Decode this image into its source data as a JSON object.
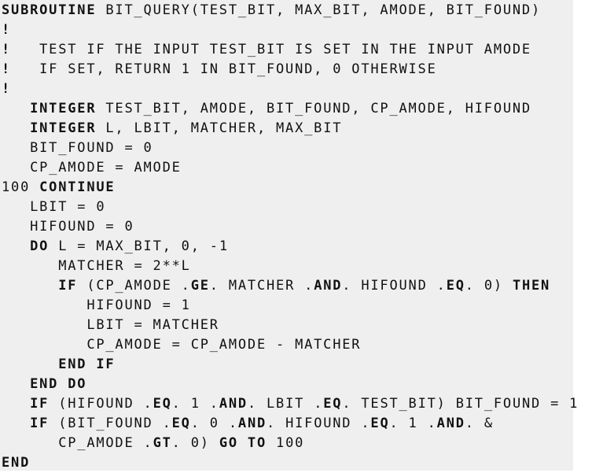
{
  "document": {
    "lines": [
      [
        {
          "t": "SUBROUTINE",
          "b": true
        },
        {
          "t": " BIT_QUERY(TEST_BIT, MAX_BIT, AMODE, BIT_FOUND)",
          "b": false
        }
      ],
      [
        {
          "t": "!",
          "b": true
        }
      ],
      [
        {
          "t": "!",
          "b": true
        },
        {
          "t": "   TEST IF THE INPUT TEST_BIT IS SET IN THE INPUT AMODE",
          "b": false
        }
      ],
      [
        {
          "t": "!",
          "b": true
        },
        {
          "t": "   IF SET, RETURN 1 IN BIT_FOUND, 0 OTHERWISE",
          "b": false
        }
      ],
      [
        {
          "t": "!",
          "b": true
        }
      ],
      [
        {
          "t": "   ",
          "b": false
        },
        {
          "t": "INTEGER",
          "b": true
        },
        {
          "t": " TEST_BIT, AMODE, BIT_FOUND, CP_AMODE, HIFOUND",
          "b": false
        }
      ],
      [
        {
          "t": "   ",
          "b": false
        },
        {
          "t": "INTEGER",
          "b": true
        },
        {
          "t": " L, LBIT, MATCHER, MAX_BIT",
          "b": false
        }
      ],
      [
        {
          "t": "   BIT_FOUND = 0",
          "b": false
        }
      ],
      [
        {
          "t": "   CP_AMODE = AMODE",
          "b": false
        }
      ],
      [
        {
          "t": "100 ",
          "b": false
        },
        {
          "t": "CONTINUE",
          "b": true
        }
      ],
      [
        {
          "t": "   LBIT = 0",
          "b": false
        }
      ],
      [
        {
          "t": "   HIFOUND = 0",
          "b": false
        }
      ],
      [
        {
          "t": "   ",
          "b": false
        },
        {
          "t": "DO",
          "b": true
        },
        {
          "t": " L = MAX_BIT, 0, -1",
          "b": false
        }
      ],
      [
        {
          "t": "      MATCHER = 2**L",
          "b": false
        }
      ],
      [
        {
          "t": "      ",
          "b": false
        },
        {
          "t": "IF",
          "b": true
        },
        {
          "t": " (CP_AMODE .",
          "b": false
        },
        {
          "t": "GE",
          "b": true
        },
        {
          "t": ". MATCHER .",
          "b": false
        },
        {
          "t": "AND",
          "b": true
        },
        {
          "t": ". HIFOUND .",
          "b": false
        },
        {
          "t": "EQ",
          "b": true
        },
        {
          "t": ". 0) ",
          "b": false
        },
        {
          "t": "THEN",
          "b": true
        }
      ],
      [
        {
          "t": "         HIFOUND = 1",
          "b": false
        }
      ],
      [
        {
          "t": "         LBIT = MATCHER",
          "b": false
        }
      ],
      [
        {
          "t": "         CP_AMODE = CP_AMODE - MATCHER",
          "b": false
        }
      ],
      [
        {
          "t": "      ",
          "b": false
        },
        {
          "t": "END IF",
          "b": true
        }
      ],
      [
        {
          "t": "   ",
          "b": false
        },
        {
          "t": "END DO",
          "b": true
        }
      ],
      [
        {
          "t": "   ",
          "b": false
        },
        {
          "t": "IF",
          "b": true
        },
        {
          "t": " (HIFOUND .",
          "b": false
        },
        {
          "t": "EQ",
          "b": true
        },
        {
          "t": ". 1 .",
          "b": false
        },
        {
          "t": "AND",
          "b": true
        },
        {
          "t": ". LBIT .",
          "b": false
        },
        {
          "t": "EQ",
          "b": true
        },
        {
          "t": ". TEST_BIT) BIT_FOUND = 1",
          "b": false
        }
      ],
      [
        {
          "t": "   ",
          "b": false
        },
        {
          "t": "IF",
          "b": true
        },
        {
          "t": " (BIT_FOUND .",
          "b": false
        },
        {
          "t": "EQ",
          "b": true
        },
        {
          "t": ". 0 .",
          "b": false
        },
        {
          "t": "AND",
          "b": true
        },
        {
          "t": ". HIFOUND .",
          "b": false
        },
        {
          "t": "EQ",
          "b": true
        },
        {
          "t": ". 1 .",
          "b": false
        },
        {
          "t": "AND",
          "b": true
        },
        {
          "t": ". &",
          "b": false
        }
      ],
      [
        {
          "t": "      CP_AMODE .",
          "b": false
        },
        {
          "t": "GT",
          "b": true
        },
        {
          "t": ". 0) ",
          "b": false
        },
        {
          "t": "GO TO",
          "b": true
        },
        {
          "t": " 100",
          "b": false
        }
      ],
      [
        {
          "t": "END",
          "b": true
        }
      ]
    ]
  }
}
